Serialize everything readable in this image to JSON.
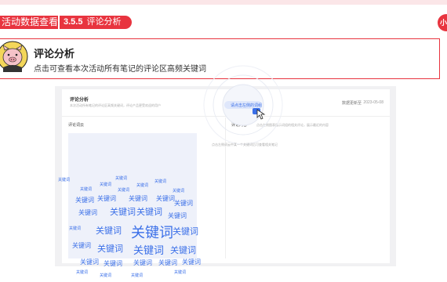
{
  "header_tag": {
    "title": "活动数据查看",
    "section_number": "3.5.5",
    "section_name": "评论分析"
  },
  "brand": {
    "logo_text": "小",
    "accent": "#e8343f"
  },
  "section": {
    "title": "评论分析",
    "subtitle": "点击可查看本次活动所有笔记的评论区高频关键词"
  },
  "card": {
    "title": "评论分析",
    "description": "本次活动所有笔记的评论区高频关键词，评论产品更受欢迎的用户",
    "update_label": "数据更新至",
    "update_date": "2023-05-08"
  },
  "left_panel": {
    "title": "评论词云"
  },
  "right_panel": {
    "title": "评论内容",
    "description": "点击左侧图表展示词组的相关评论，展示最近的内容",
    "empty_button": "请点击左侧的词组",
    "empty_hint": "点击左侧词云中某一个关键词后可查看相关笔记"
  },
  "word_cloud": [
    {
      "text": "关键词",
      "weight": 1
    },
    {
      "text": "关键词",
      "weight": 1
    },
    {
      "text": "关键词",
      "weight": 1
    },
    {
      "text": "关键词",
      "weight": 1
    },
    {
      "text": "关键词",
      "weight": 1
    },
    {
      "text": "关键词",
      "weight": 1
    },
    {
      "text": "关键词",
      "weight": 1
    },
    {
      "text": "关键词",
      "weight": 1
    },
    {
      "text": "关键词",
      "weight": 2
    },
    {
      "text": "关键词",
      "weight": 2
    },
    {
      "text": "关键词",
      "weight": 2
    },
    {
      "text": "关键词",
      "weight": 2
    },
    {
      "text": "关键词",
      "weight": 2
    },
    {
      "text": "关键词",
      "weight": 2
    },
    {
      "text": "关键词",
      "weight": 3
    },
    {
      "text": "关键词",
      "weight": 3
    },
    {
      "text": "关键词",
      "weight": 2
    },
    {
      "text": "关键词",
      "weight": 1
    },
    {
      "text": "关键词",
      "weight": 3
    },
    {
      "text": "关键词",
      "weight": 5
    },
    {
      "text": "关键词",
      "weight": 3
    },
    {
      "text": "关键词",
      "weight": 2
    },
    {
      "text": "关键词",
      "weight": 3
    },
    {
      "text": "关键词",
      "weight": 4
    },
    {
      "text": "关键词",
      "weight": 3
    },
    {
      "text": "关键词",
      "weight": 2
    },
    {
      "text": "关键词",
      "weight": 2
    },
    {
      "text": "关键词",
      "weight": 2
    },
    {
      "text": "关键词",
      "weight": 2
    },
    {
      "text": "关键词",
      "weight": 2
    },
    {
      "text": "关键词",
      "weight": 1
    },
    {
      "text": "关键词",
      "weight": 1
    },
    {
      "text": "关键词",
      "weight": 1
    },
    {
      "text": "关键词",
      "weight": 1
    }
  ]
}
